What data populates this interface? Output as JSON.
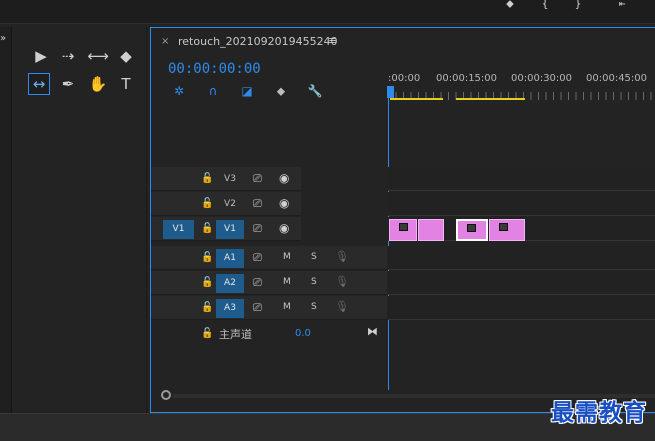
{
  "top_toolbar": {
    "icons": [
      "marker-icon",
      "in-bracket-icon",
      "out-bracket-icon",
      "go-to-in-icon"
    ]
  },
  "left_strip": {
    "chevron": "»"
  },
  "tools": [
    {
      "name": "selection-tool",
      "glyph": "▶",
      "active": false
    },
    {
      "name": "track-select-tool",
      "glyph": "⇢",
      "active": false
    },
    {
      "name": "ripple-edit-tool",
      "glyph": "⟷",
      "active": false
    },
    {
      "name": "razor-tool",
      "glyph": "◆",
      "active": false
    },
    {
      "name": "slip-tool",
      "glyph": "↔",
      "active": true
    },
    {
      "name": "pen-tool",
      "glyph": "✒",
      "active": false
    },
    {
      "name": "hand-tool",
      "glyph": "✋",
      "active": false
    },
    {
      "name": "type-tool",
      "glyph": "T",
      "active": false
    }
  ],
  "timeline": {
    "close_glyph": "×",
    "title": "retouch_2021092019455240",
    "menu_glyph": "≡",
    "timecode": "00:00:00:00",
    "ruler_labels": [
      ":00:00",
      "00:00:15:00",
      "00:00:30:00",
      "00:00:45:00"
    ],
    "video_tracks": [
      {
        "source": "",
        "name": "V3",
        "targeted": false
      },
      {
        "source": "",
        "name": "V2",
        "targeted": false
      },
      {
        "source": "V1",
        "name": "V1",
        "targeted": true
      }
    ],
    "audio_tracks": [
      {
        "name": "A1",
        "mute": "M",
        "solo": "S"
      },
      {
        "name": "A2",
        "mute": "M",
        "solo": "S"
      },
      {
        "name": "A3",
        "mute": "M",
        "solo": "S"
      }
    ],
    "master": {
      "label": "主声道",
      "value": "0.0"
    }
  },
  "watermark": "最需教育"
}
